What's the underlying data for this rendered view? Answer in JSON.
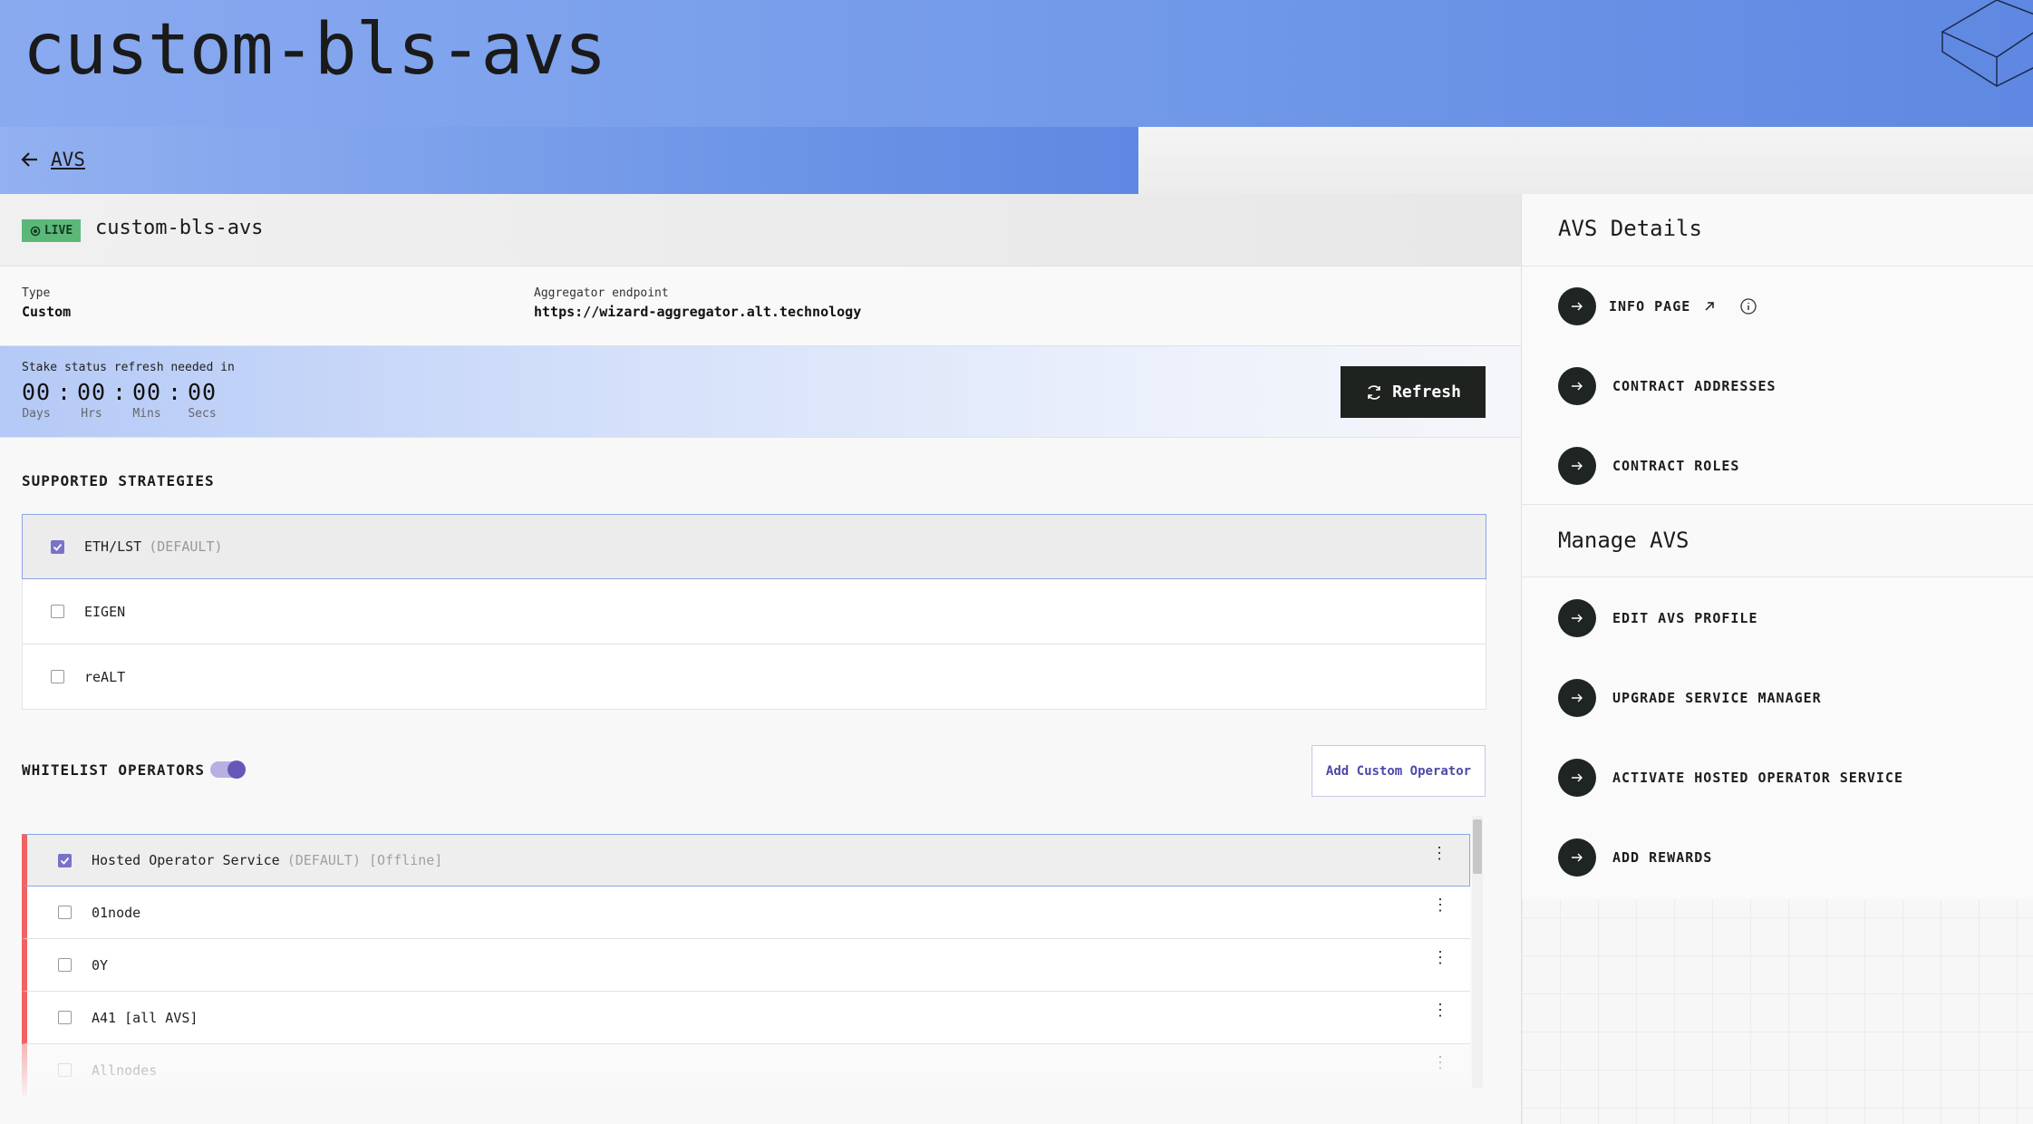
{
  "header": {
    "title": "custom-bls-avs"
  },
  "breadcrumb": {
    "back_label": "AVS"
  },
  "avs": {
    "status": "LIVE",
    "name": "custom-bls-avs",
    "type_label": "Type",
    "type_value": "Custom",
    "aggregator_label": "Aggregator endpoint",
    "aggregator_value": "https://wizard-aggregator.alt.technology"
  },
  "stake": {
    "label": "Stake status refresh needed in",
    "days": "00",
    "hrs": "00",
    "mins": "00",
    "secs": "00",
    "days_label": "Days",
    "hrs_label": "Hrs",
    "mins_label": "Mins",
    "secs_label": "Secs",
    "refresh_label": "Refresh"
  },
  "strategies": {
    "title": "SUPPORTED STRATEGIES",
    "items": [
      {
        "name": "ETH/LST",
        "tag": "(DEFAULT)",
        "checked": true
      },
      {
        "name": "EIGEN",
        "tag": "",
        "checked": false
      },
      {
        "name": "reALT",
        "tag": "",
        "checked": false
      }
    ]
  },
  "whitelist": {
    "title": "WHITELIST OPERATORS",
    "add_label": "Add Custom Operator",
    "operators": [
      {
        "name": "Hosted Operator Service",
        "tag": "(DEFAULT) [Offline]",
        "checked": true
      },
      {
        "name": "01node",
        "tag": "",
        "checked": false
      },
      {
        "name": "0Y",
        "tag": "",
        "checked": false
      },
      {
        "name": "A41 [all AVS]",
        "tag": "",
        "checked": false
      },
      {
        "name": "Allnodes",
        "tag": "",
        "checked": false
      }
    ]
  },
  "details": {
    "title": "AVS Details",
    "info_page": "INFO PAGE",
    "contract_addresses": "CONTRACT ADDRESSES",
    "contract_roles": "CONTRACT ROLES"
  },
  "manage": {
    "title": "Manage AVS",
    "edit_profile": "EDIT AVS PROFILE",
    "upgrade_service": "UPGRADE SERVICE MANAGER",
    "activate_hosted": "ACTIVATE HOSTED OPERATOR SERVICE",
    "add_rewards": "ADD REWARDS"
  },
  "colors": {
    "header_blue": "#6f98e8",
    "live_green": "#5cb879",
    "operator_offline": "#f26262",
    "accent_purple": "#6459b8",
    "dark_button": "#1e2320"
  }
}
